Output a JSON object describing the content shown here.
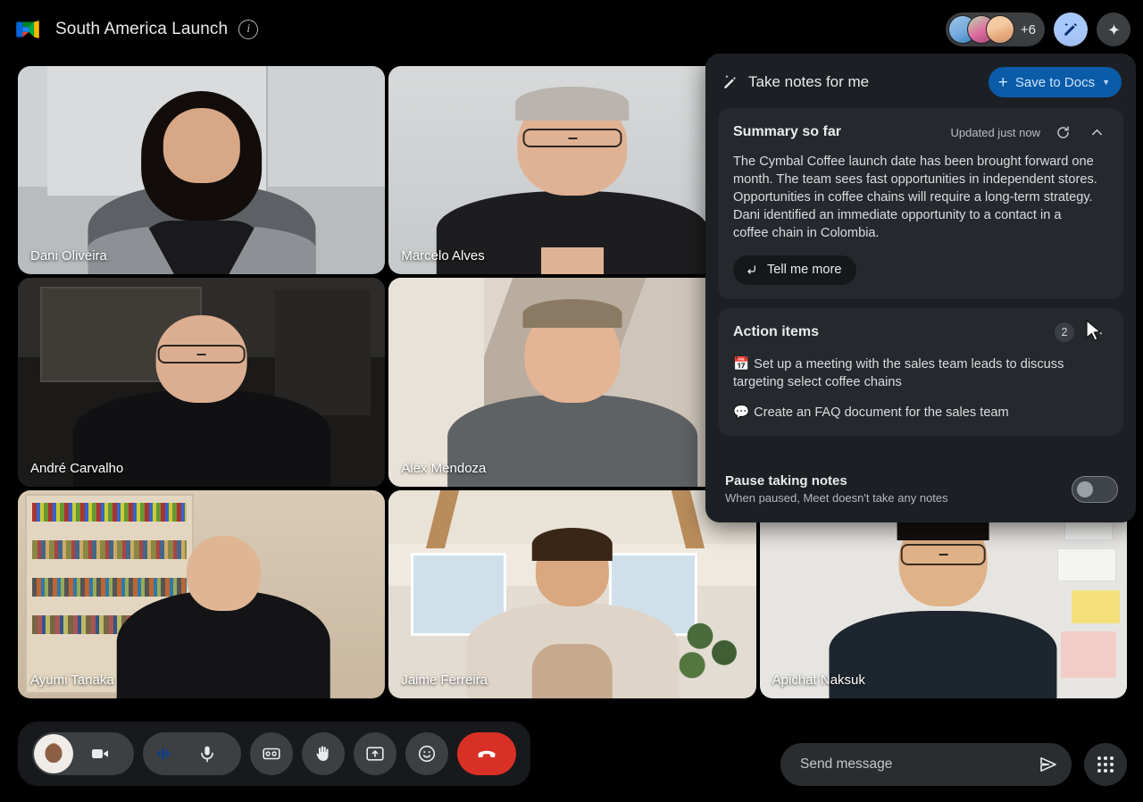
{
  "header": {
    "title": "South America Launch",
    "logo_icon": "google-meet-logo",
    "info_icon": "info-icon",
    "avatar_overflow": "+6",
    "notes_icon": "notes-pencil-icon",
    "gemini_icon": "gemini-sparkle-icon"
  },
  "grid": {
    "tiles": [
      {
        "name": "Dani Oliveira"
      },
      {
        "name": "Marcelo Alves"
      },
      {
        "name": ""
      },
      {
        "name": "André Carvalho"
      },
      {
        "name": "Alex Mendoza"
      },
      {
        "name": ""
      },
      {
        "name": "Ayumi Tanaka"
      },
      {
        "name": "Jaime Ferreira"
      },
      {
        "name": "Apichat Naksuk"
      }
    ]
  },
  "notes_panel": {
    "title": "Take notes for me",
    "title_icon": "magic-pencil-icon",
    "save_button": {
      "label": "Save to Docs",
      "plus_icon": "plus-icon",
      "caret_icon": "chevron-down-icon"
    },
    "summary": {
      "title": "Summary so far",
      "updated": "Updated just now",
      "refresh_icon": "refresh-icon",
      "collapse_icon": "chevron-up-icon",
      "body": "The Cymbal Coffee launch date has been brought forward one month. The team sees fast opportunities in independent stores. Opportunities in coffee chains will require a long-term strategy. Dani identified an immediate opportunity to a contact in a coffee chain in Colombia.",
      "tell_me_more": "Tell me more",
      "tell_me_more_icon": "return-arrow-icon"
    },
    "action_items": {
      "title": "Action items",
      "count": "2",
      "collapse_icon": "chevron-up-icon",
      "items": [
        {
          "emoji": "📅",
          "icon_name": "calendar-emoji",
          "text": "Set up a meeting with the sales team leads to discuss targeting select coffee chains"
        },
        {
          "emoji": "💬",
          "icon_name": "speech-bubble-emoji",
          "text": "Create an FAQ document for the sales team"
        }
      ]
    },
    "pause": {
      "title": "Pause taking notes",
      "subtitle": "When paused, Meet doesn't take any notes",
      "toggle_state": "off"
    }
  },
  "controls": {
    "camera_icon": "video-camera-icon",
    "audio_wave_icon": "audio-waveform-icon",
    "mic_icon": "microphone-icon",
    "captions_icon": "closed-captions-icon",
    "raise_hand_icon": "raise-hand-icon",
    "present_icon": "present-screen-icon",
    "emoji_icon": "emoji-reaction-icon",
    "end_call_icon": "end-call-icon",
    "self_avatar": "self-view-avatar"
  },
  "chat": {
    "placeholder": "Send message",
    "value": "",
    "send_icon": "send-icon",
    "apps_icon": "apps-grid-icon"
  },
  "colors": {
    "accent_blue": "#0a5ca8",
    "accent_blue_text": "#cfe4ff",
    "panel_bg": "#1c2024",
    "card_bg": "#25292d",
    "end_call_red": "#d93025",
    "active_blue": "#a8c7fa"
  }
}
